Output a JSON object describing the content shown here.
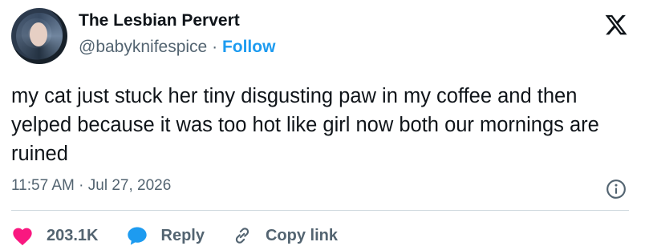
{
  "user": {
    "display_name": "The Lesbian Pervert",
    "handle": "@babyknifespice",
    "separator": "·",
    "follow_label": "Follow",
    "avatar_icon": "user-avatar"
  },
  "brand": {
    "logo_icon": "x-logo-icon"
  },
  "tweet": {
    "text": "my cat just stuck her tiny disgusting paw in my coffee and then yelped because it was too hot like girl now both our mornings are ruined",
    "timestamp": "11:57 AM · Jul 27, 2026",
    "info_icon": "info-icon"
  },
  "actions": {
    "like_count": "203.1K",
    "reply_label": "Reply",
    "copy_link_label": "Copy link",
    "like_icon": "heart-icon",
    "reply_icon": "speech-bubble-icon",
    "copy_icon": "link-icon"
  },
  "colors": {
    "text": "#0f1419",
    "secondary": "#536471",
    "accent": "#1d9bf0",
    "like": "#f91880",
    "divider": "#cfd9de"
  }
}
